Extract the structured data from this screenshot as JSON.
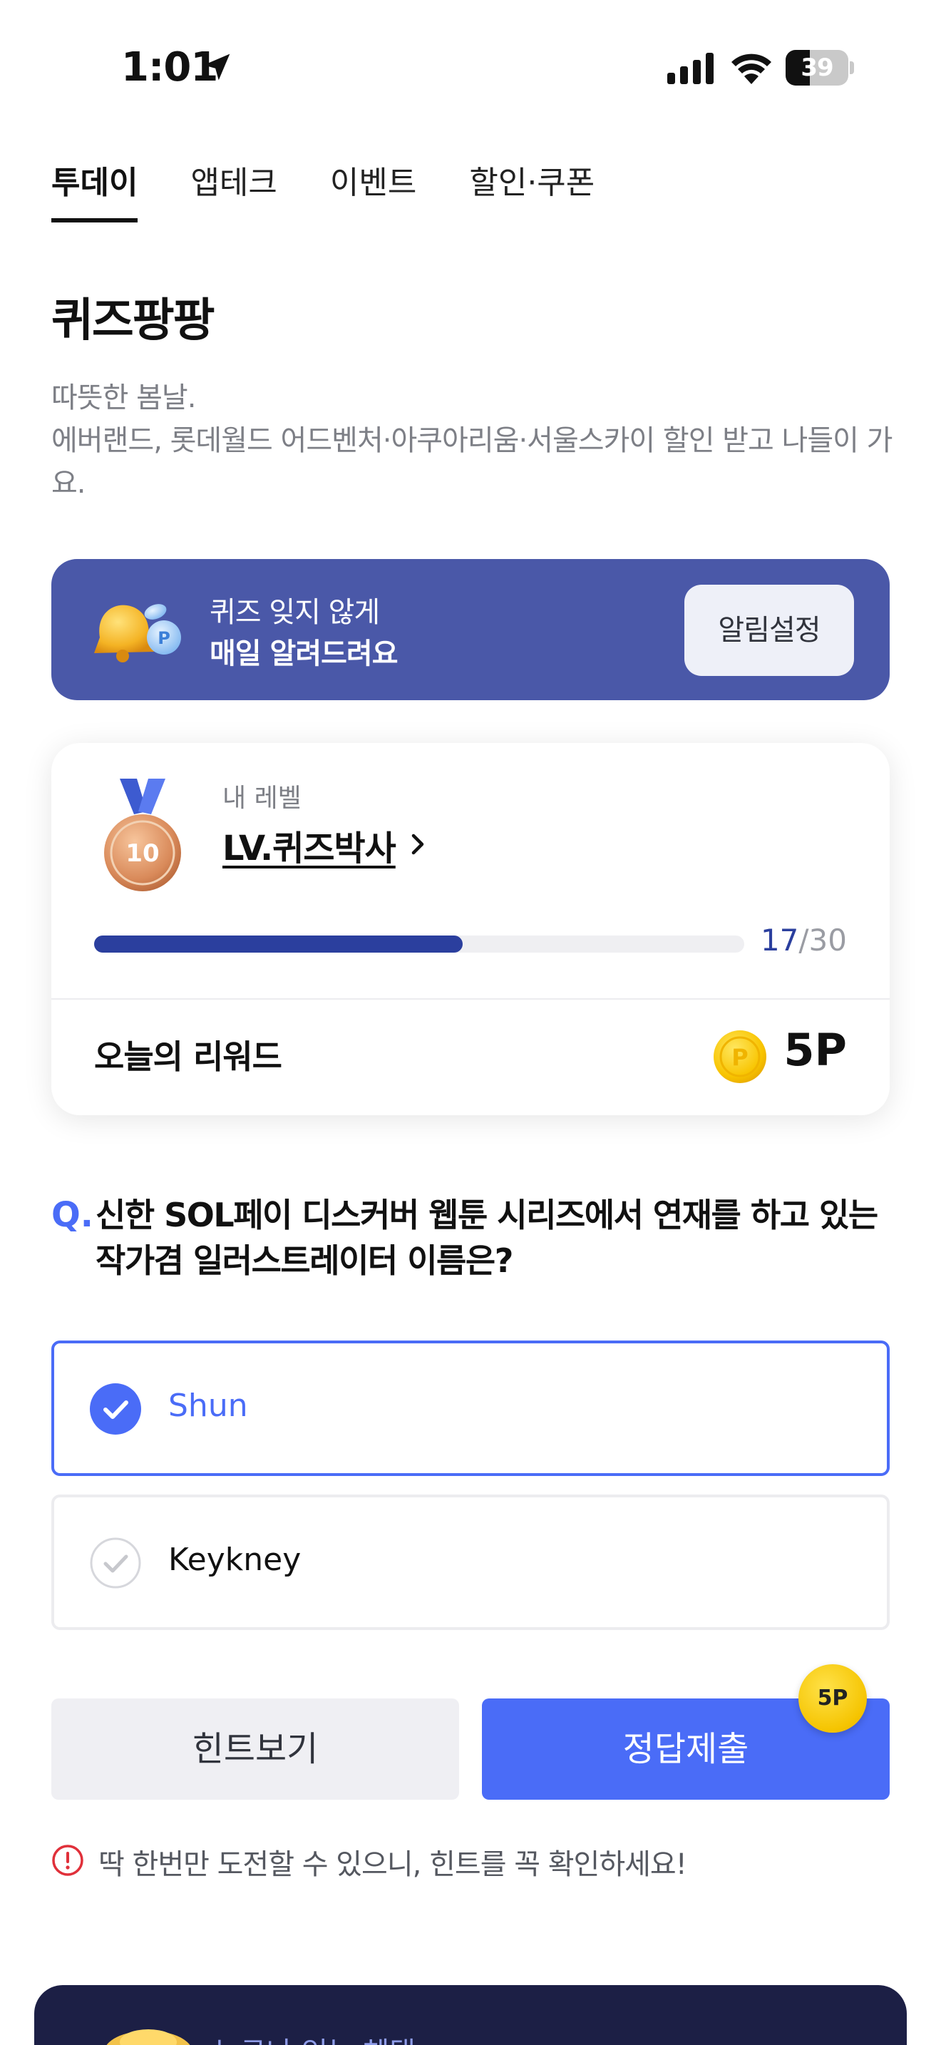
{
  "status_bar": {
    "time": "1:01",
    "battery": "39",
    "battery_level": 0.39
  },
  "tabs": [
    {
      "label": "투데이",
      "active": true
    },
    {
      "label": "앱테크",
      "active": false
    },
    {
      "label": "이벤트",
      "active": false
    },
    {
      "label": "할인·쿠폰",
      "active": false
    }
  ],
  "page": {
    "title": "퀴즈팡팡",
    "description_line1": "따뜻한 봄날.",
    "description_line2": "에버랜드, 롯데월드 어드벤처·아쿠아리움·서울스카이 할인 받고 나들이 가요."
  },
  "banner": {
    "line1": "퀴즈 잊지 않게",
    "line2": "매일 알려드려요",
    "button_label": "알림설정",
    "bg_color": "#4a58a8"
  },
  "level": {
    "label": "내 레벨",
    "name": "LV.퀴즈박사",
    "medal_number": "10",
    "progress_current": "17",
    "progress_separator": "/",
    "progress_total": "30",
    "progress_fraction": 0.567,
    "reward_label": "오늘의 리워드",
    "reward_value": "5P"
  },
  "quiz": {
    "q_mark": "Q.",
    "question": "신한 SOL페이 디스커버 웹툰 시리즈에서 연재를 하고 있는 작가겸 일러스트레이터 이름은?",
    "options": [
      {
        "label": "Shun",
        "selected": true
      },
      {
        "label": "Keykney",
        "selected": false
      }
    ]
  },
  "actions": {
    "hint_label": "힌트보기",
    "submit_label": "정답제출",
    "submit_badge": "5P"
  },
  "warning": {
    "text": "딱 한번만 도전할 수 있으니, 힌트를 꼭 확인하세요!"
  },
  "bottom_card": {
    "text": "누구나 얻는 혜택"
  },
  "colors": {
    "accent": "#4a6cf7",
    "progress": "#2b3f9e",
    "bottom_card": "#1c1f45"
  }
}
